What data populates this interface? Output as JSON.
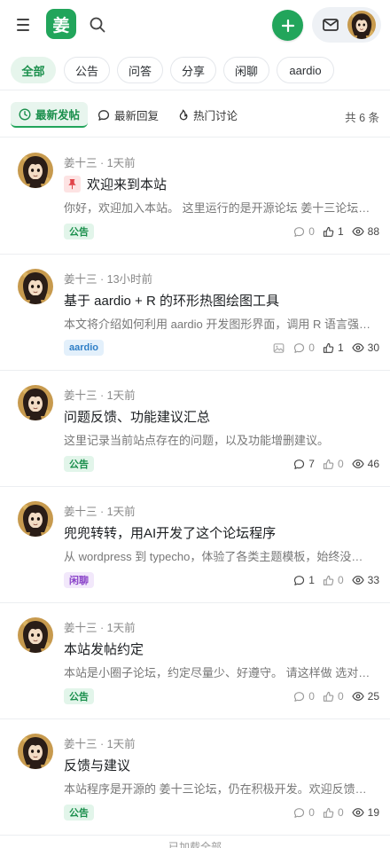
{
  "header": {
    "logo_text": "姜",
    "brand_color": "#22a55b"
  },
  "categories": [
    {
      "label": "全部",
      "active": true
    },
    {
      "label": "公告",
      "active": false
    },
    {
      "label": "问答",
      "active": false
    },
    {
      "label": "分享",
      "active": false
    },
    {
      "label": "闲聊",
      "active": false
    },
    {
      "label": "aardio",
      "active": false
    }
  ],
  "sort": {
    "options": [
      {
        "label": "最新发帖",
        "icon": "clock-icon",
        "active": true
      },
      {
        "label": "最新回复",
        "icon": "chat-icon",
        "active": false
      },
      {
        "label": "热门讨论",
        "icon": "flame-icon",
        "active": false
      }
    ],
    "total": "共 6 条"
  },
  "posts": [
    {
      "author": "姜十三",
      "time": "1天前",
      "pinned": true,
      "title": "欢迎来到本站",
      "excerpt": "你好，欢迎加入本站。 这里运行的是开源论坛 姜十三论坛，在这里你可以发帖、回复、点赞和收藏。",
      "tag": "公告",
      "tag_color": "green",
      "has_image": false,
      "comments": "0",
      "likes": "1",
      "views": "88"
    },
    {
      "author": "姜十三",
      "time": "13小时前",
      "pinned": false,
      "title": "基于 aardio + R 的环形热图绘图工具",
      "excerpt": "本文将介绍如何利用 aardio 开发图形界面，调用 R 语言强大的绘图能力。",
      "tag": "aardio",
      "tag_color": "blue",
      "has_image": true,
      "comments": "0",
      "likes": "1",
      "views": "30"
    },
    {
      "author": "姜十三",
      "time": "1天前",
      "pinned": false,
      "title": "问题反馈、功能建议汇总",
      "excerpt": "这里记录当前站点存在的问题，以及功能增删建议。",
      "tag": "公告",
      "tag_color": "green",
      "has_image": false,
      "comments": "7",
      "likes": "0",
      "views": "46"
    },
    {
      "author": "姜十三",
      "time": "1天前",
      "pinned": false,
      "title": "兜兜转转，用AI开发了这个论坛程序",
      "excerpt": "从 wordpress 到 typecho，体验了各类主题模板，始终没有找到满意的。",
      "tag": "闲聊",
      "tag_color": "purple",
      "has_image": false,
      "comments": "1",
      "likes": "0",
      "views": "33"
    },
    {
      "author": "姜十三",
      "time": "1天前",
      "pinned": false,
      "title": "本站发帖约定",
      "excerpt": "本站是小圈子论坛，约定尽量少、好遵守。 请这样做 选对分类后再发帖。",
      "tag": "公告",
      "tag_color": "green",
      "has_image": false,
      "comments": "0",
      "likes": "0",
      "views": "25"
    },
    {
      "author": "姜十三",
      "time": "1天前",
      "pinned": false,
      "title": "反馈与建议",
      "excerpt": "本站程序是开源的 姜十三论坛，仍在积极开发。欢迎反馈问题和建议。",
      "tag": "公告",
      "tag_color": "green",
      "has_image": false,
      "comments": "0",
      "likes": "0",
      "views": "19"
    }
  ],
  "footer": "已加载全部"
}
